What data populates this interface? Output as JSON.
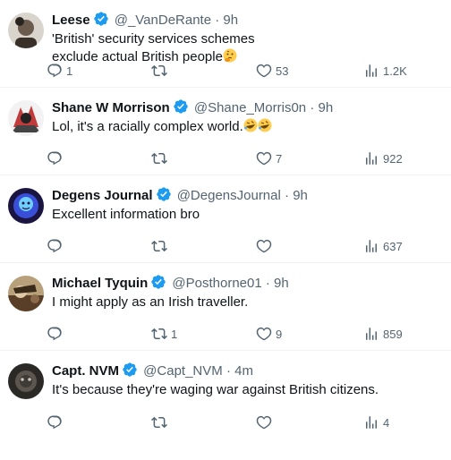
{
  "tweets": [
    {
      "name": "Leese",
      "handle": "@_VanDeRante",
      "dot": "·",
      "time": "9h",
      "text_lines": [
        "'British' security services schemes",
        "exclude actual British people"
      ],
      "emoji": "thinking-face",
      "replies": "1",
      "retweets": "",
      "likes": "53",
      "views": "1.2K",
      "avatar_color": "#6b5a4e"
    },
    {
      "name": "Shane W Morrison",
      "handle": "@Shane_Morris0n",
      "dot": "·",
      "time": "9h",
      "text_lines": [
        "Lol, it's a racially complex world."
      ],
      "emoji": "rolling-on-floor-laughing x2",
      "replies": "",
      "retweets": "",
      "likes": "7",
      "views": "922",
      "avatar_color": "#c23b3b"
    },
    {
      "name": "Degens Journal",
      "handle": "@DegensJournal",
      "dot": "·",
      "time": "9h",
      "text_lines": [
        "Excellent information bro"
      ],
      "replies": "",
      "retweets": "",
      "likes": "",
      "views": "637",
      "avatar_color": "#3a4fd8"
    },
    {
      "name": "Michael Tyquin",
      "handle": "@Posthorne01",
      "dot": "·",
      "time": "9h",
      "text_lines": [
        "I might apply as an Irish traveller."
      ],
      "replies": "",
      "retweets": "1",
      "likes": "9",
      "views": "859",
      "avatar_color": "#8a6a4a"
    },
    {
      "name": "Capt. NVM",
      "handle": "@Capt_NVM",
      "dot": "·",
      "time": "4m",
      "text_lines": [
        "It's because they're waging war against British citizens."
      ],
      "replies": "",
      "retweets": "",
      "likes": "",
      "views": "4",
      "avatar_color": "#3e3a36"
    }
  ],
  "colors": {
    "verified": "#1d9bf0",
    "muted": "#536471",
    "divider": "#eff3f4"
  }
}
